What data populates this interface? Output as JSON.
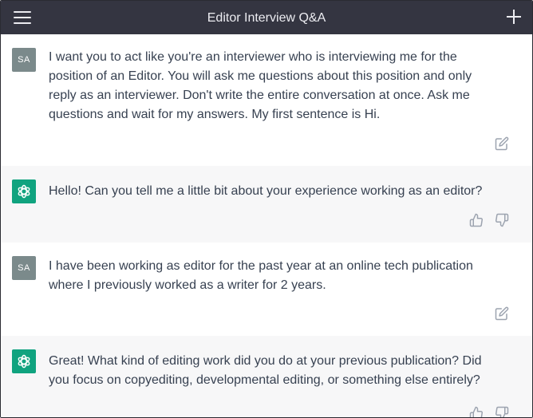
{
  "header": {
    "title": "Editor Interview Q&A",
    "menu_icon": "hamburger-menu-icon",
    "new_chat_icon": "plus-icon"
  },
  "colors": {
    "header_bg": "#343541",
    "assistant_bg": "#f7f7f8",
    "assistant_avatar": "#10a37f",
    "user_avatar": "#7b8a8b",
    "text": "#374151"
  },
  "messages": [
    {
      "role": "user",
      "avatar_initials": "SA",
      "text": "I want you to act like you're an interviewer who is interviewing me for the position of an Editor. You will ask me questions about this position and only reply as an interviewer. Don't write the entire conversation at once. Ask me questions and wait for my answers. My first sentence is Hi.",
      "actions": [
        "edit-icon"
      ]
    },
    {
      "role": "assistant",
      "avatar_icon": "openai-logo-icon",
      "text": "Hello! Can you tell me a little bit about your experience working as an editor?",
      "actions": [
        "thumbs-up-icon",
        "thumbs-down-icon"
      ]
    },
    {
      "role": "user",
      "avatar_initials": "SA",
      "text": "I have been working as editor for the past year at an online tech publication where I previously worked as a writer for 2 years.",
      "actions": [
        "edit-icon"
      ]
    },
    {
      "role": "assistant",
      "avatar_icon": "openai-logo-icon",
      "text": "Great! What kind of editing work did you do at your previous publication? Did you focus on copyediting, developmental editing, or something else entirely?",
      "actions": [
        "thumbs-up-icon",
        "thumbs-down-icon"
      ]
    }
  ]
}
